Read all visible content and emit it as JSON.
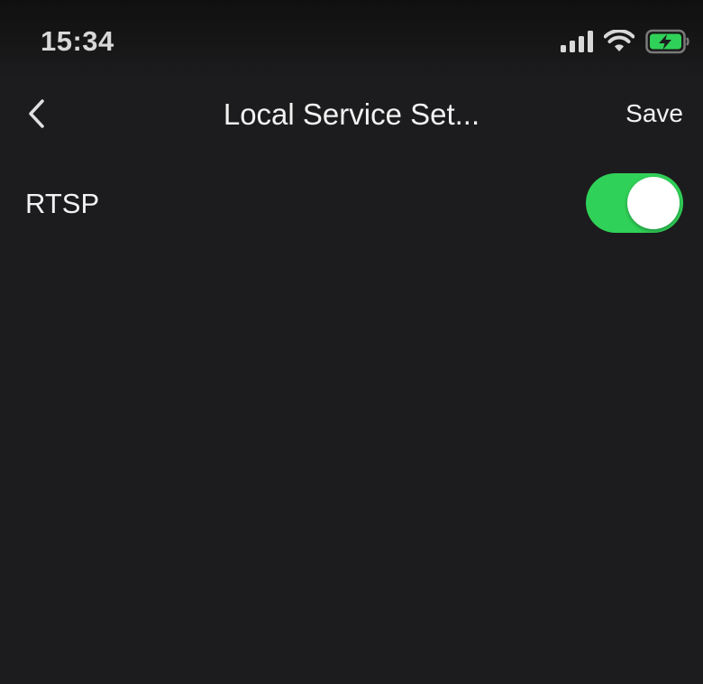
{
  "status_bar": {
    "time": "15:34",
    "icons": [
      "cellular-signal-icon",
      "wifi-icon",
      "battery-charging-icon"
    ],
    "battery_color": "#30d158"
  },
  "nav": {
    "back_icon": "chevron-left-icon",
    "title": "Local Service Set...",
    "save_label": "Save"
  },
  "settings": {
    "rtsp": {
      "label": "RTSP",
      "enabled": true,
      "toggle_color": "#30d158"
    }
  },
  "colors": {
    "background": "#1c1c1e",
    "text": "#f2f2f2",
    "accent": "#30d158"
  }
}
